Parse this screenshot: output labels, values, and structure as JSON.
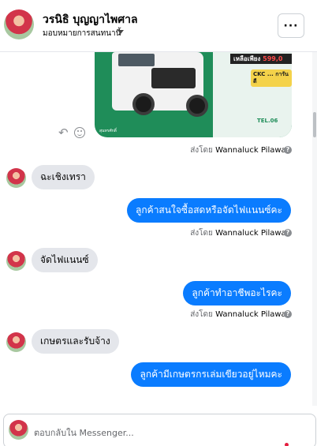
{
  "header": {
    "name": "วรนิธิ บุญญาไพศาล",
    "assign_label": "มอบหมายการสนทนานี้",
    "more_label": "···"
  },
  "image_message": {
    "price_text": "เหลือเพียง",
    "price_value": "599,0",
    "promo_text": "CKC ... การันตี",
    "tel_text": "TEL.06",
    "credit_text": "สุนทรศักดิ์"
  },
  "messages": [
    {
      "type": "sent_by",
      "prefix": "ส่งโดย",
      "name": "Wannaluck Pilawan"
    },
    {
      "type": "incoming",
      "text": "ฉะเชิงเทรา"
    },
    {
      "type": "outgoing",
      "text": "ลูกค้าสนใจซื้อสดหรือจัดไฟแนนซ์คะ"
    },
    {
      "type": "sent_by",
      "prefix": "ส่งโดย",
      "name": "Wannaluck Pilawan"
    },
    {
      "type": "incoming",
      "text": "จัดไฟแนนซ์"
    },
    {
      "type": "outgoing",
      "text": "ลูกค้าทำอาชีพอะไรคะ"
    },
    {
      "type": "sent_by",
      "prefix": "ส่งโดย",
      "name": "Wannaluck Pilawan"
    },
    {
      "type": "incoming",
      "text": "เกษตรและรับจ้าง"
    },
    {
      "type": "outgoing",
      "text": "ลูกค้ามีเกษตรกรเล่มเขียวอยู่ไหมคะ"
    }
  ],
  "composer": {
    "placeholder": "ตอบกลับใน Messenger..."
  },
  "icons": {
    "more": "more-dots-icon",
    "caret": "caret-down-icon",
    "reply": "reply-icon",
    "react": "emoji-icon",
    "info": "question-icon"
  },
  "colors": {
    "outgoing_bubble": "#0a7cff",
    "incoming_bubble": "#e4e6eb",
    "notification_dot": "#e41e3f"
  }
}
